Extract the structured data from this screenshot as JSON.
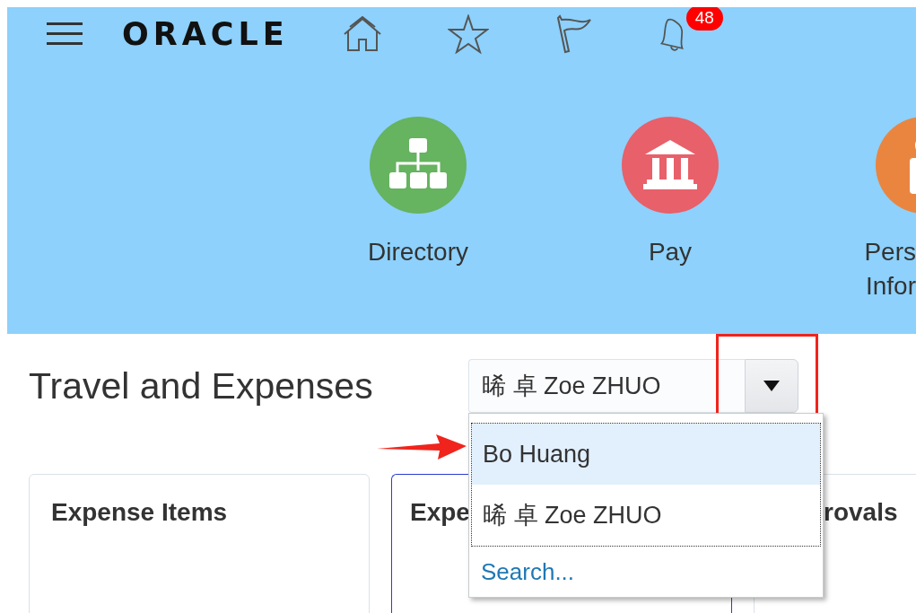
{
  "header": {
    "logo": "ORACLE",
    "notification_count": "48"
  },
  "springboard": [
    {
      "kind": "directory",
      "color": "#66b360",
      "label_lines": [
        "Directory"
      ]
    },
    {
      "kind": "pay",
      "color": "#e8606a",
      "label_lines": [
        "Pay"
      ]
    },
    {
      "kind": "person",
      "color": "#ea8540",
      "label_lines": [
        "Pers",
        "Infor"
      ]
    }
  ],
  "page_title": "Travel and Expenses",
  "person_select": {
    "value": "晞 卓 Zoe ZHUO",
    "expanded": true,
    "options": [
      {
        "label": "Bo Huang",
        "highlighted": true
      },
      {
        "label": "晞 卓 Zoe ZHUO",
        "highlighted": false
      }
    ],
    "search_link": "Search..."
  },
  "cards": [
    {
      "title": "Expense Items",
      "focused": false
    },
    {
      "title": "Expe",
      "focused": true
    },
    {
      "title": "rovals",
      "focused": false
    }
  ]
}
